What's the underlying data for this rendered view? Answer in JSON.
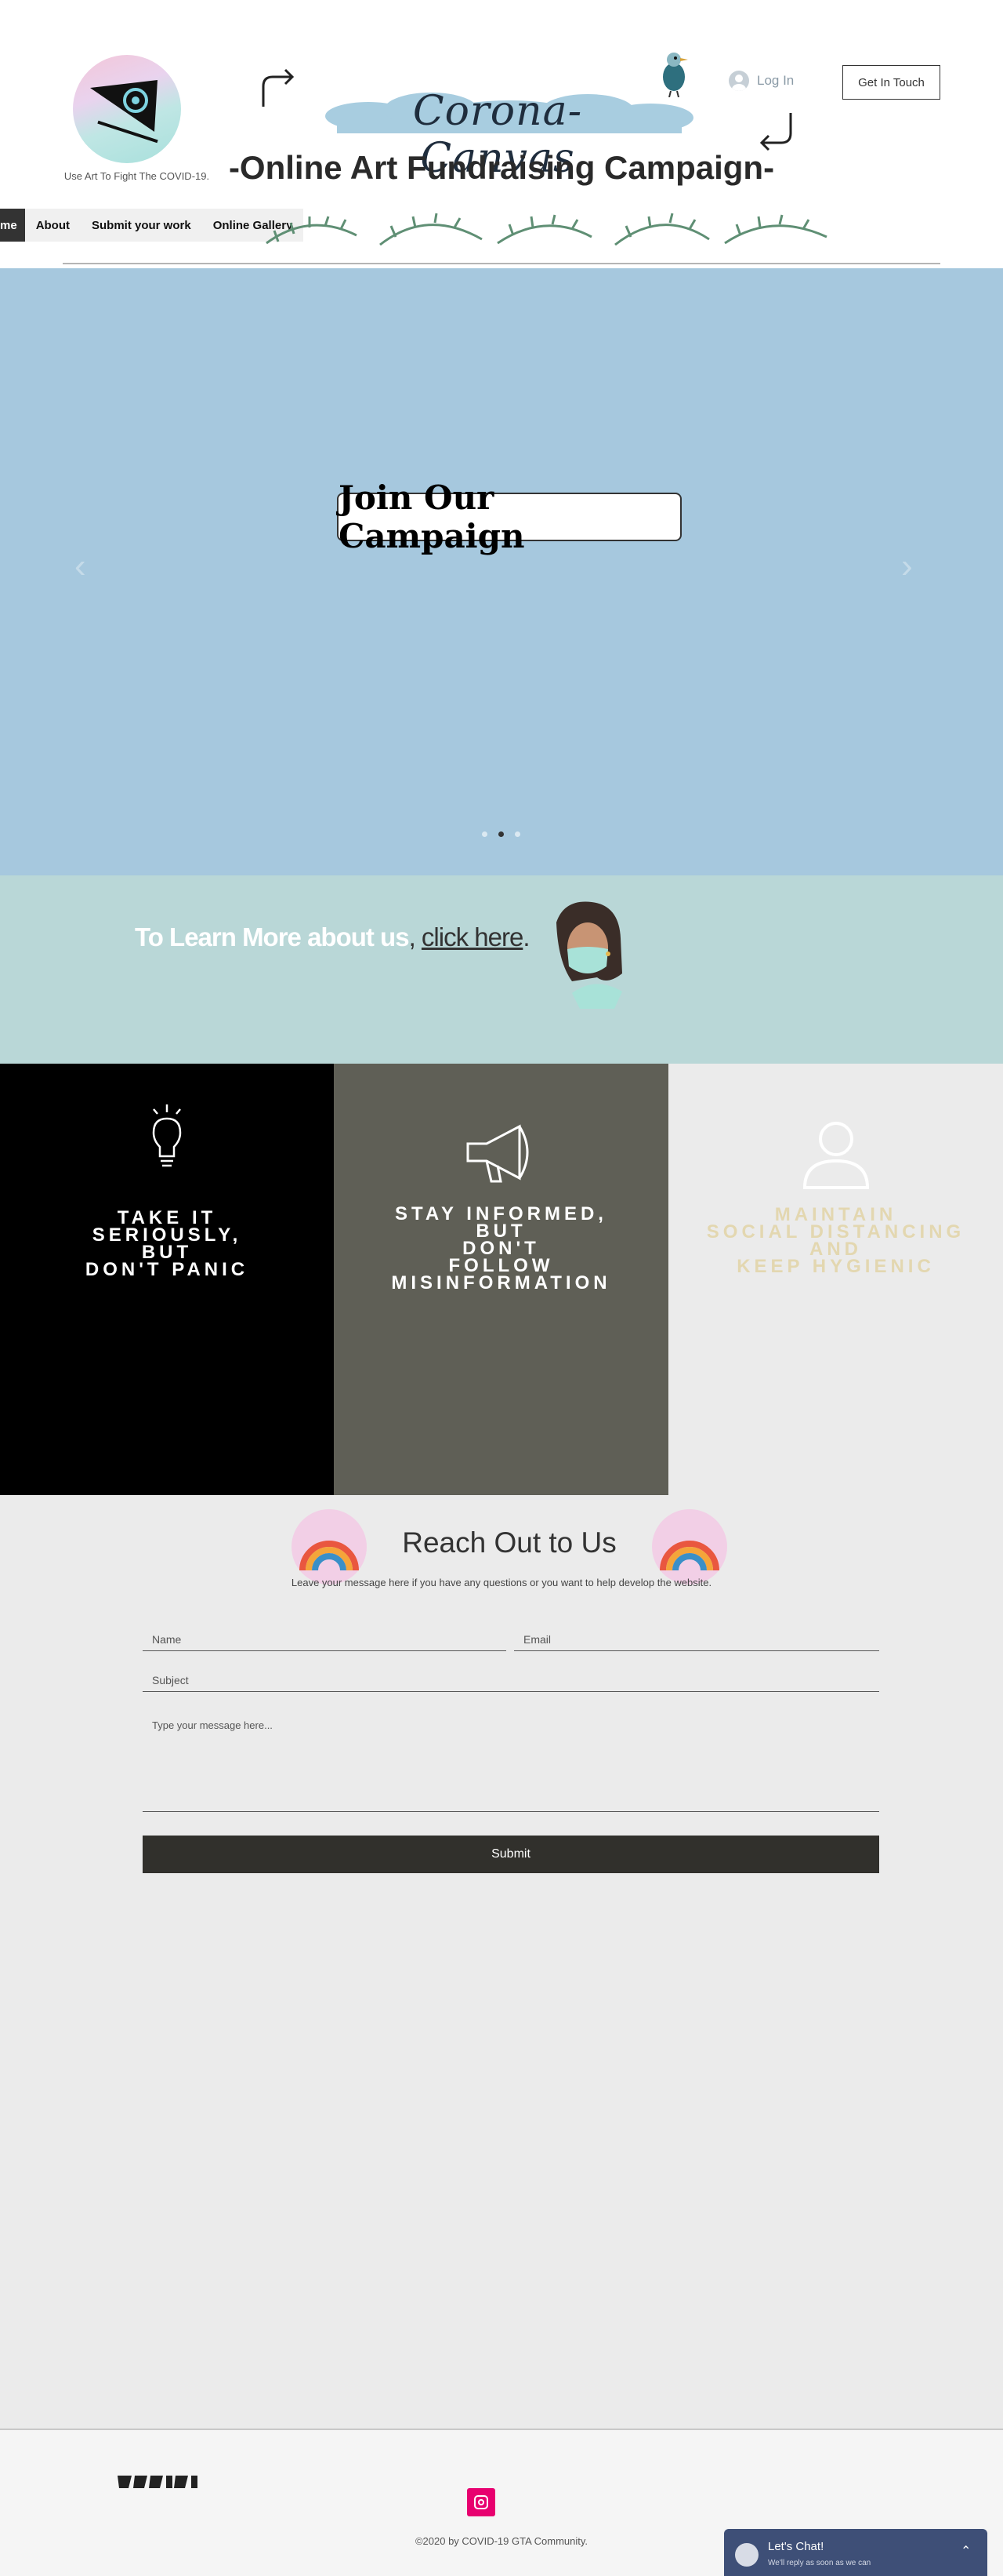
{
  "header": {
    "tagline": "Use Art To Fight The COVID-19.",
    "brand": "Corona-Canvas",
    "campaign_title": "-Online Art Fundraising Campaign-",
    "login_label": "Log In",
    "get_in_touch_label": "Get In Touch"
  },
  "nav": {
    "items": [
      {
        "label": "me"
      },
      {
        "label": "About"
      },
      {
        "label": "Submit your work"
      },
      {
        "label": "Online Gallery"
      }
    ]
  },
  "hero": {
    "button_label": "Join Our Campaign",
    "slide_count": 3,
    "active_slide": 1
  },
  "learn": {
    "lead": "To Learn More about us",
    "separator": ",",
    "link": "click here",
    "end": "."
  },
  "tips": [
    {
      "lines": [
        "TAKE IT",
        "SERIOUSLY,",
        "BUT",
        "DON'T PANIC"
      ],
      "icon": "lightbulb-icon"
    },
    {
      "lines": [
        "STAY INFORMED,",
        "BUT",
        "DON'T",
        "FOLLOW",
        "MISINFORMATION"
      ],
      "icon": "megaphone-icon"
    },
    {
      "lines": [
        "MAINTAIN",
        "SOCIAL DISTANCING",
        "AND",
        "KEEP HYGIENIC"
      ],
      "icon": "person-icon"
    }
  ],
  "contact": {
    "title": "Reach Out to Us",
    "subtitle": "Leave your message here if you have any questions or you want to help develop the website.",
    "name_placeholder": "Name",
    "email_placeholder": "Email",
    "subject_placeholder": "Subject",
    "message_placeholder": "Type your message here...",
    "submit_label": "Submit"
  },
  "footer": {
    "copyright": "©2020 by COVID-19 GTA Community.",
    "chat_title": "Let's Chat!",
    "chat_subtitle": "We'll reply as soon as we can"
  },
  "colors": {
    "hero_bg": "#a6c8de",
    "learn_bg": "#b9d7d7",
    "tip1_bg": "#000000",
    "tip2_bg": "#5f5f56",
    "tip3_text": "#e3d7b0",
    "chat_bg": "#3e4f77",
    "instagram": "#e8006f"
  }
}
